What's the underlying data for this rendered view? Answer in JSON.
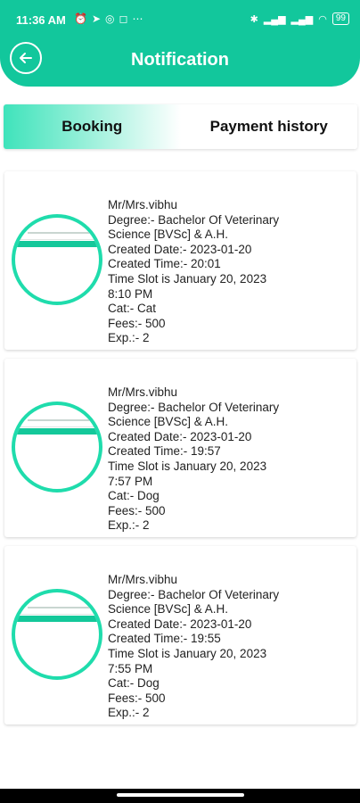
{
  "status": {
    "time": "11:36 AM",
    "left_icons": [
      "alarm-icon",
      "telegram-icon",
      "whatsapp-icon",
      "instagram-icon",
      "more-icon"
    ],
    "battery": "99"
  },
  "header": {
    "title": "Notification"
  },
  "tabs": [
    {
      "label": "Booking",
      "active": true
    },
    {
      "label": "Payment history",
      "active": false
    }
  ],
  "bookings": [
    {
      "name": "Mr/Mrs.vibhu",
      "degree_line1": "Degree:- Bachelor Of Veterinary",
      "degree_line2": "Science [BVSc] & A.H.",
      "created_date": "Created Date:- 2023-01-20",
      "created_time": "Created Time:- 20:01",
      "time_slot_line1": "Time Slot is January 20, 2023",
      "time_slot_line2": "8:10 PM",
      "cat": "Cat:- Cat",
      "fees": "Fees:- 500",
      "exp": "Exp.:- 2"
    },
    {
      "name": "Mr/Mrs.vibhu",
      "degree_line1": "Degree:- Bachelor Of Veterinary",
      "degree_line2": "Science [BVSc] & A.H.",
      "created_date": "Created Date:- 2023-01-20",
      "created_time": "Created Time:- 19:57",
      "time_slot_line1": "Time Slot is January 20, 2023",
      "time_slot_line2": "7:57 PM",
      "cat": "Cat:- Dog",
      "fees": "Fees:- 500",
      "exp": "Exp.:- 2"
    },
    {
      "name": "Mr/Mrs.vibhu",
      "degree_line1": "Degree:- Bachelor Of Veterinary",
      "degree_line2": "Science [BVSc] & A.H.",
      "created_date": "Created Date:- 2023-01-20",
      "created_time": "Created Time:- 19:55",
      "time_slot_line1": "Time Slot is January 20, 2023",
      "time_slot_line2": "7:55 PM",
      "cat": "Cat:- Dog",
      "fees": "Fees:- 500",
      "exp": "Exp.:- 2"
    }
  ],
  "colors": {
    "primary": "#12c79c",
    "avatar_ring": "#1fdcac"
  }
}
